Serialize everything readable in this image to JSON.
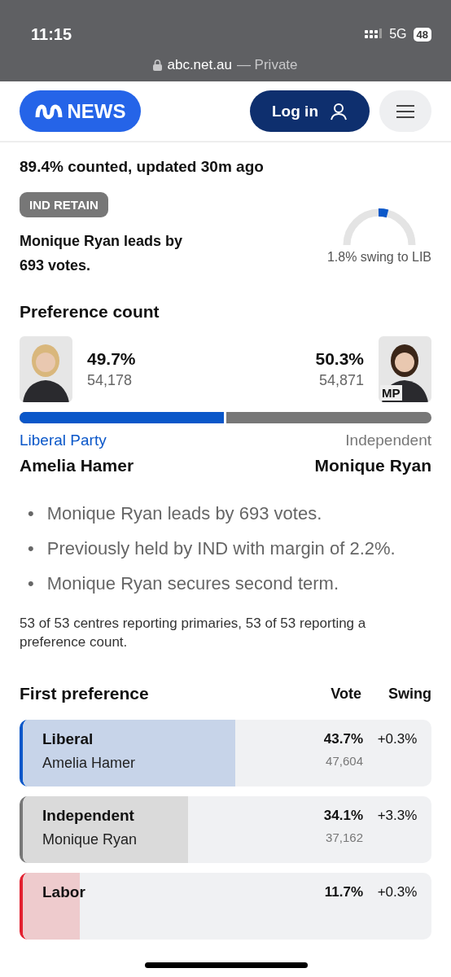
{
  "status_bar": {
    "time": "11:15",
    "network": "5G",
    "battery": "48"
  },
  "address_bar": {
    "domain": "abc.net.au",
    "mode": "— Private"
  },
  "header": {
    "logo": "NEWS",
    "login": "Log in"
  },
  "summary": {
    "counted": "89.4% counted, updated 30m ago",
    "badge": "IND RETAIN",
    "lead": "Monique Ryan leads by 693 votes.",
    "swing": "1.8% swing to LIB"
  },
  "preference": {
    "title": "Preference count",
    "level": 0.497,
    "candidates": [
      {
        "percent": "49.7%",
        "votes": "54,178",
        "party": "Liberal Party",
        "name": "Amelia Hamer",
        "color": "#0a57c9"
      },
      {
        "percent": "50.3%",
        "votes": "54,871",
        "party": "Independent",
        "name": "Monique Ryan",
        "color": "#777777",
        "badge": "MP"
      }
    ]
  },
  "notes": [
    {
      "bullet": "•",
      "text": "Monique Ryan leads by 693 votes."
    },
    {
      "bullet": "•",
      "text": "Previously held by IND with margin of 2.2%."
    },
    {
      "bullet": "•",
      "text": "Monique Ryan secures second term."
    }
  ],
  "reporting": "53 of 53 centres reporting primaries, 53 of 53 reporting a preference count.",
  "first_preference": {
    "title": "First preference",
    "columns": [
      "Vote",
      "Swing"
    ],
    "rows": [
      {
        "party": "Liberal",
        "candidate": "Amelia Hamer",
        "percent": "43.7%",
        "votes": "47,604",
        "swing": "+0.3%",
        "color": "#0a57c9",
        "level": 0.52
      },
      {
        "party": "Independent",
        "candidate": "Monique Ryan",
        "percent": "34.1%",
        "votes": "37,162",
        "swing": "+3.3%",
        "color": "#777777",
        "level": 0.405
      },
      {
        "party": "Labor",
        "percent": "11.7%",
        "swing": "+0.3%",
        "color": "#e3202f",
        "level": 0.14
      }
    ]
  }
}
